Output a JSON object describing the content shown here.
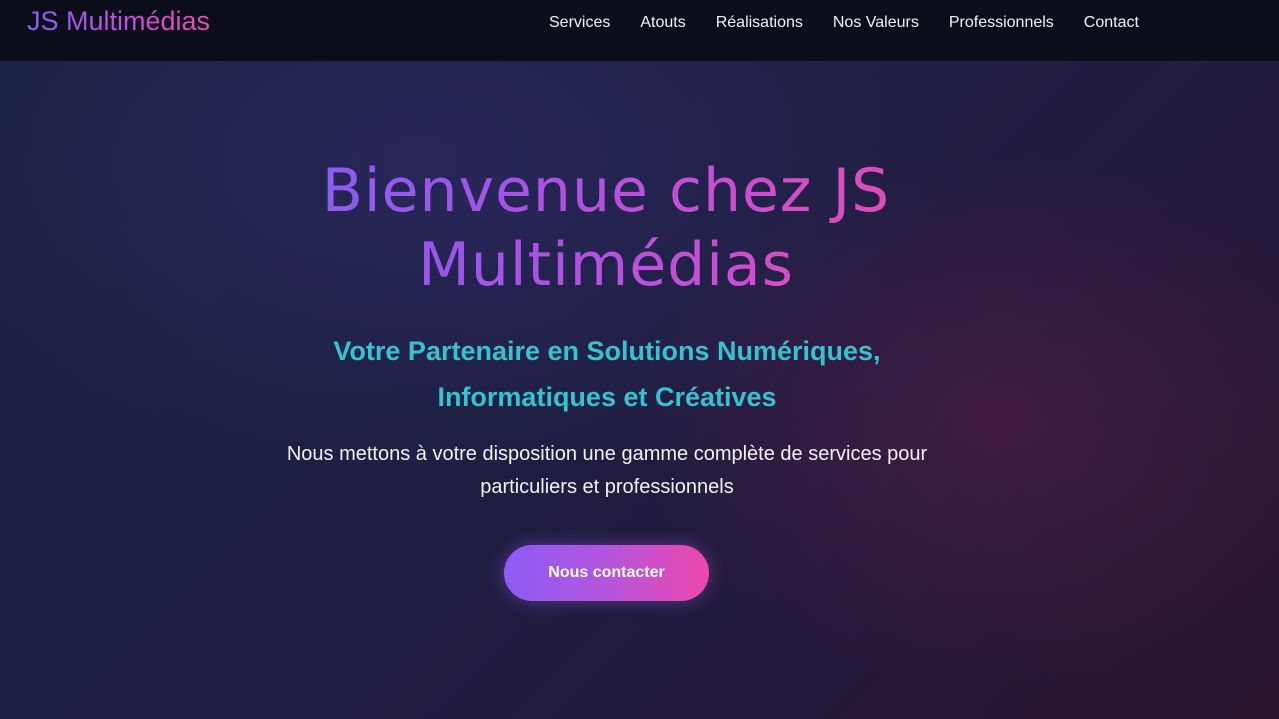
{
  "navbar": {
    "brand": "JS Multimédias",
    "links": [
      {
        "label": "Services"
      },
      {
        "label": "Atouts"
      },
      {
        "label": "Réalisations"
      },
      {
        "label": "Nos Valeurs"
      },
      {
        "label": "Professionnels"
      },
      {
        "label": "Contact"
      }
    ]
  },
  "hero": {
    "title_line1": "Bienvenue chez JS",
    "title_line2": "Multimédias",
    "subtitle_line1": "Votre Partenaire en Solutions Numériques,",
    "subtitle_line2": "Informatiques et Créatives",
    "text_line1": "Nous mettons à votre disposition une gamme complète de services pour",
    "text_line2": "particuliers et professionnels",
    "cta_label": "Nous contacter"
  },
  "colors": {
    "nav_background": "#0c0e1a",
    "gradient_start": "#8a5cf6",
    "gradient_end": "#ee47ad",
    "subtitle": "#35c3cf",
    "text": "#f2f2f6"
  }
}
